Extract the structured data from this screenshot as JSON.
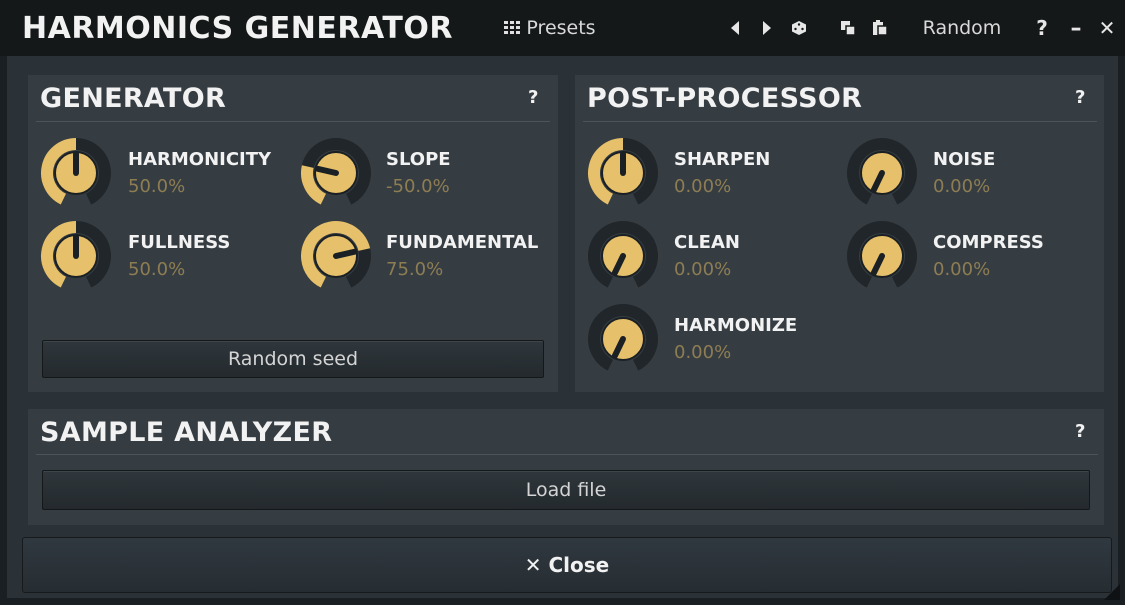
{
  "app": {
    "title": "HARMONICS GENERATOR"
  },
  "toolbar": {
    "presets_icon": "grid-icon",
    "presets_label": "Presets",
    "prev_icon": "triangle-left-icon",
    "next_icon": "triangle-right-icon",
    "dice_icon": "dice-icon",
    "copy_icon": "copy-icon",
    "paste_icon": "paste-icon",
    "random_label": "Random",
    "help_label": "?",
    "minimize_label": "–",
    "close_label": "✕"
  },
  "colors": {
    "accent": "#e6c06a",
    "track": "#20262a",
    "knob_body": "#2b3136",
    "value_text": "#8e7d52"
  },
  "generator": {
    "title": "GENERATOR",
    "help": "?",
    "params": [
      {
        "label": "HARMONICITY",
        "value": "50.0%",
        "level": 0.5
      },
      {
        "label": "SLOPE",
        "value": "-50.0%",
        "level": 0.25
      },
      {
        "label": "FULLNESS",
        "value": "50.0%",
        "level": 0.5
      },
      {
        "label": "FUNDAMENTAL",
        "value": "75.0%",
        "level": 0.75
      }
    ],
    "random_seed_label": "Random seed"
  },
  "post": {
    "title": "POST-PROCESSOR",
    "help": "?",
    "params": [
      {
        "label": "SHARPEN",
        "value": "0.00%",
        "level": 0.5
      },
      {
        "label": "NOISE",
        "value": "0.00%",
        "level": 0.0
      },
      {
        "label": "CLEAN",
        "value": "0.00%",
        "level": 0.0
      },
      {
        "label": "COMPRESS",
        "value": "0.00%",
        "level": 0.0
      },
      {
        "label": "HARMONIZE",
        "value": "0.00%",
        "level": 0.0
      }
    ]
  },
  "analyzer": {
    "title": "SAMPLE ANALYZER",
    "help": "?",
    "load_label": "Load file"
  },
  "footer": {
    "close_label": "✕ Close"
  }
}
